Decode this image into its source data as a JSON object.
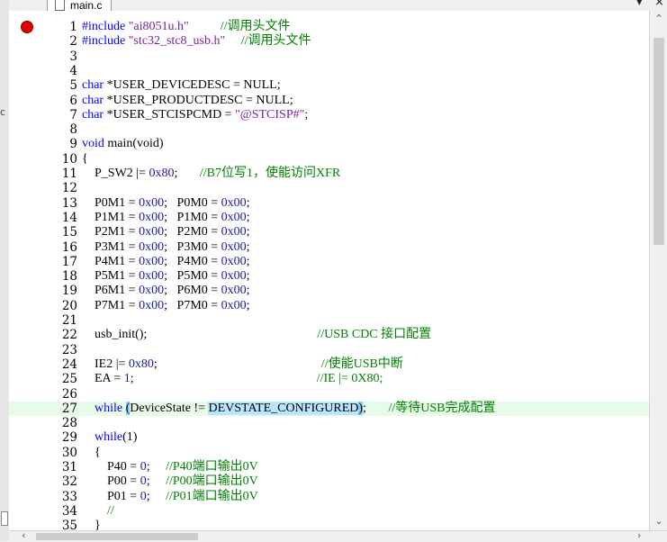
{
  "tab": {
    "filename": "main.c"
  },
  "window": {
    "close_glyph": "×",
    "menu_glyph": "▾"
  },
  "scrollbar": {
    "up": "⌃",
    "down": "⌄",
    "left": "‹",
    "right": "›"
  },
  "left_strip": {
    "mark": "c"
  },
  "breakpoint_line": 1,
  "current_line": 27,
  "lines": [
    {
      "n": "1",
      "seg": [
        [
          "kw0",
          "#include "
        ],
        [
          "str",
          "\"ai8051u.h\""
        ],
        [
          "p",
          "          "
        ],
        [
          "cm",
          "//调用头文件"
        ]
      ]
    },
    {
      "n": "2",
      "seg": [
        [
          "kw0",
          "#include "
        ],
        [
          "str",
          "\"stc32_stc8_usb.h\""
        ],
        [
          "p",
          "     "
        ],
        [
          "cm",
          "//调用头文件"
        ]
      ]
    },
    {
      "n": "3",
      "seg": []
    },
    {
      "n": "4",
      "seg": []
    },
    {
      "n": "5",
      "seg": [
        [
          "kw",
          "char"
        ],
        [
          "p",
          " *USER_DEVICEDESC = NULL;"
        ]
      ]
    },
    {
      "n": "6",
      "seg": [
        [
          "kw",
          "char"
        ],
        [
          "p",
          " *USER_PRODUCTDESC = NULL;"
        ]
      ]
    },
    {
      "n": "7",
      "seg": [
        [
          "kw",
          "char"
        ],
        [
          "p",
          " *USER_STCISPCMD = "
        ],
        [
          "str",
          "\"@STCISP#\""
        ],
        [
          "p",
          ";"
        ]
      ]
    },
    {
      "n": "8",
      "seg": []
    },
    {
      "n": "9",
      "seg": [
        [
          "kw",
          "void"
        ],
        [
          "p",
          " main(void)"
        ]
      ]
    },
    {
      "n": "10",
      "seg": [
        [
          "p",
          "{"
        ]
      ]
    },
    {
      "n": "11",
      "seg": [
        [
          "p",
          "    P_SW2 |= "
        ],
        [
          "num",
          "0x80"
        ],
        [
          "p",
          ";       "
        ],
        [
          "cm",
          "//B7位写1，使能访问XFR"
        ]
      ]
    },
    {
      "n": "12",
      "seg": []
    },
    {
      "n": "13",
      "seg": [
        [
          "p",
          "    P0M1 = "
        ],
        [
          "num",
          "0x00"
        ],
        [
          "p",
          ";   P0M0 = "
        ],
        [
          "num",
          "0x00"
        ],
        [
          "p",
          ";"
        ]
      ]
    },
    {
      "n": "14",
      "seg": [
        [
          "p",
          "    P1M1 = "
        ],
        [
          "num",
          "0x00"
        ],
        [
          "p",
          ";   P1M0 = "
        ],
        [
          "num",
          "0x00"
        ],
        [
          "p",
          ";"
        ]
      ]
    },
    {
      "n": "15",
      "seg": [
        [
          "p",
          "    P2M1 = "
        ],
        [
          "num",
          "0x00"
        ],
        [
          "p",
          ";   P2M0 = "
        ],
        [
          "num",
          "0x00"
        ],
        [
          "p",
          ";"
        ]
      ]
    },
    {
      "n": "16",
      "seg": [
        [
          "p",
          "    P3M1 = "
        ],
        [
          "num",
          "0x00"
        ],
        [
          "p",
          ";   P3M0 = "
        ],
        [
          "num",
          "0x00"
        ],
        [
          "p",
          ";"
        ]
      ]
    },
    {
      "n": "17",
      "seg": [
        [
          "p",
          "    P4M1 = "
        ],
        [
          "num",
          "0x00"
        ],
        [
          "p",
          ";   P4M0 = "
        ],
        [
          "num",
          "0x00"
        ],
        [
          "p",
          ";"
        ]
      ]
    },
    {
      "n": "18",
      "seg": [
        [
          "p",
          "    P5M1 = "
        ],
        [
          "num",
          "0x00"
        ],
        [
          "p",
          ";   P5M0 = "
        ],
        [
          "num",
          "0x00"
        ],
        [
          "p",
          ";"
        ]
      ]
    },
    {
      "n": "19",
      "seg": [
        [
          "p",
          "    P6M1 = "
        ],
        [
          "num",
          "0x00"
        ],
        [
          "p",
          ";   P6M0 = "
        ],
        [
          "num",
          "0x00"
        ],
        [
          "p",
          ";"
        ]
      ]
    },
    {
      "n": "20",
      "seg": [
        [
          "p",
          "    P7M1 = "
        ],
        [
          "num",
          "0x00"
        ],
        [
          "p",
          ";   P7M0 = "
        ],
        [
          "num",
          "0x00"
        ],
        [
          "p",
          ";"
        ]
      ]
    },
    {
      "n": "21",
      "seg": []
    },
    {
      "n": "22",
      "seg": [
        [
          "p",
          "    usb_init();                                                      "
        ],
        [
          "cm",
          "//USB CDC 接口配置"
        ]
      ]
    },
    {
      "n": "23",
      "seg": []
    },
    {
      "n": "24",
      "seg": [
        [
          "p",
          "    IE2 |= "
        ],
        [
          "num",
          "0x80"
        ],
        [
          "p",
          ";                                                    "
        ],
        [
          "cm",
          "//使能USB中断"
        ]
      ]
    },
    {
      "n": "25",
      "seg": [
        [
          "p",
          "    EA = "
        ],
        [
          "num",
          "1"
        ],
        [
          "p",
          ";                                                          "
        ],
        [
          "cm",
          "//IE |= 0X80;"
        ]
      ]
    },
    {
      "n": "26",
      "seg": []
    },
    {
      "n": "27",
      "seg": [
        [
          "p",
          "    "
        ],
        [
          "kw",
          "while"
        ],
        [
          "p",
          " "
        ],
        [
          "hl2",
          "("
        ],
        [
          "p",
          "DeviceState != "
        ],
        [
          "hl",
          "DEVSTATE_CONFIGURED"
        ],
        [
          "hl2",
          ")"
        ],
        [
          "p",
          ";       "
        ],
        [
          "cm",
          "//等待USB完成配置"
        ]
      ]
    },
    {
      "n": "28",
      "seg": []
    },
    {
      "n": "29",
      "seg": [
        [
          "p",
          "    "
        ],
        [
          "kw",
          "while"
        ],
        [
          "p",
          "(1)"
        ]
      ]
    },
    {
      "n": "30",
      "seg": [
        [
          "p",
          "    {"
        ]
      ]
    },
    {
      "n": "31",
      "seg": [
        [
          "p",
          "        P40 = "
        ],
        [
          "num",
          "0"
        ],
        [
          "p",
          ";     "
        ],
        [
          "cm",
          "//P40端口输出0V"
        ]
      ]
    },
    {
      "n": "32",
      "seg": [
        [
          "p",
          "        P00 = "
        ],
        [
          "num",
          "0"
        ],
        [
          "p",
          ";     "
        ],
        [
          "cm",
          "//P00端口输出0V"
        ]
      ]
    },
    {
      "n": "33",
      "seg": [
        [
          "p",
          "        P01 = "
        ],
        [
          "num",
          "0"
        ],
        [
          "p",
          ";     "
        ],
        [
          "cm",
          "//P01端口输出0V"
        ]
      ]
    },
    {
      "n": "34",
      "seg": [
        [
          "p",
          "        "
        ],
        [
          "cm",
          "//"
        ]
      ]
    },
    {
      "n": "35",
      "seg": [
        [
          "p",
          "    }"
        ]
      ]
    }
  ]
}
